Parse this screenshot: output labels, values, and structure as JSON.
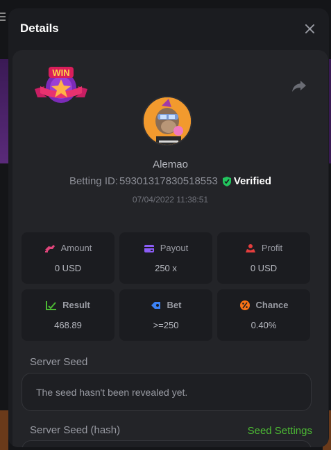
{
  "modal": {
    "title": "Details"
  },
  "bet": {
    "username": "Alemao",
    "betting_id_label": "Betting ID:",
    "betting_id": "59301317830518553",
    "verified_label": "Verified",
    "timestamp": "07/04/2022 11:38:51",
    "badge_text": "WIN"
  },
  "stats": [
    {
      "label": "Amount",
      "value": "0 USD",
      "icon": "amount-icon",
      "color": "#e0457b"
    },
    {
      "label": "Payout",
      "value": "250 x",
      "icon": "wallet-icon",
      "color": "#8b5cf6"
    },
    {
      "label": "Profit",
      "value": "0 USD",
      "icon": "profit-icon",
      "color": "#e53e3e"
    },
    {
      "label": "Result",
      "value": "468.89",
      "icon": "result-icon",
      "color": "#4cb934"
    },
    {
      "label": "Bet",
      "value": ">=250",
      "icon": "tag-icon",
      "color": "#3b82f6"
    },
    {
      "label": "Chance",
      "value": "0.40%",
      "icon": "percent-icon",
      "color": "#f97316"
    }
  ],
  "seeds": {
    "server_seed_label": "Server Seed",
    "server_seed_value": "The seed hasn't been revealed yet.",
    "server_seed_hash_label": "Server Seed (hash)",
    "seed_settings_label": "Seed Settings"
  },
  "colors": {
    "accent_green": "#4cb934",
    "verified_shield": "#22c55e"
  }
}
